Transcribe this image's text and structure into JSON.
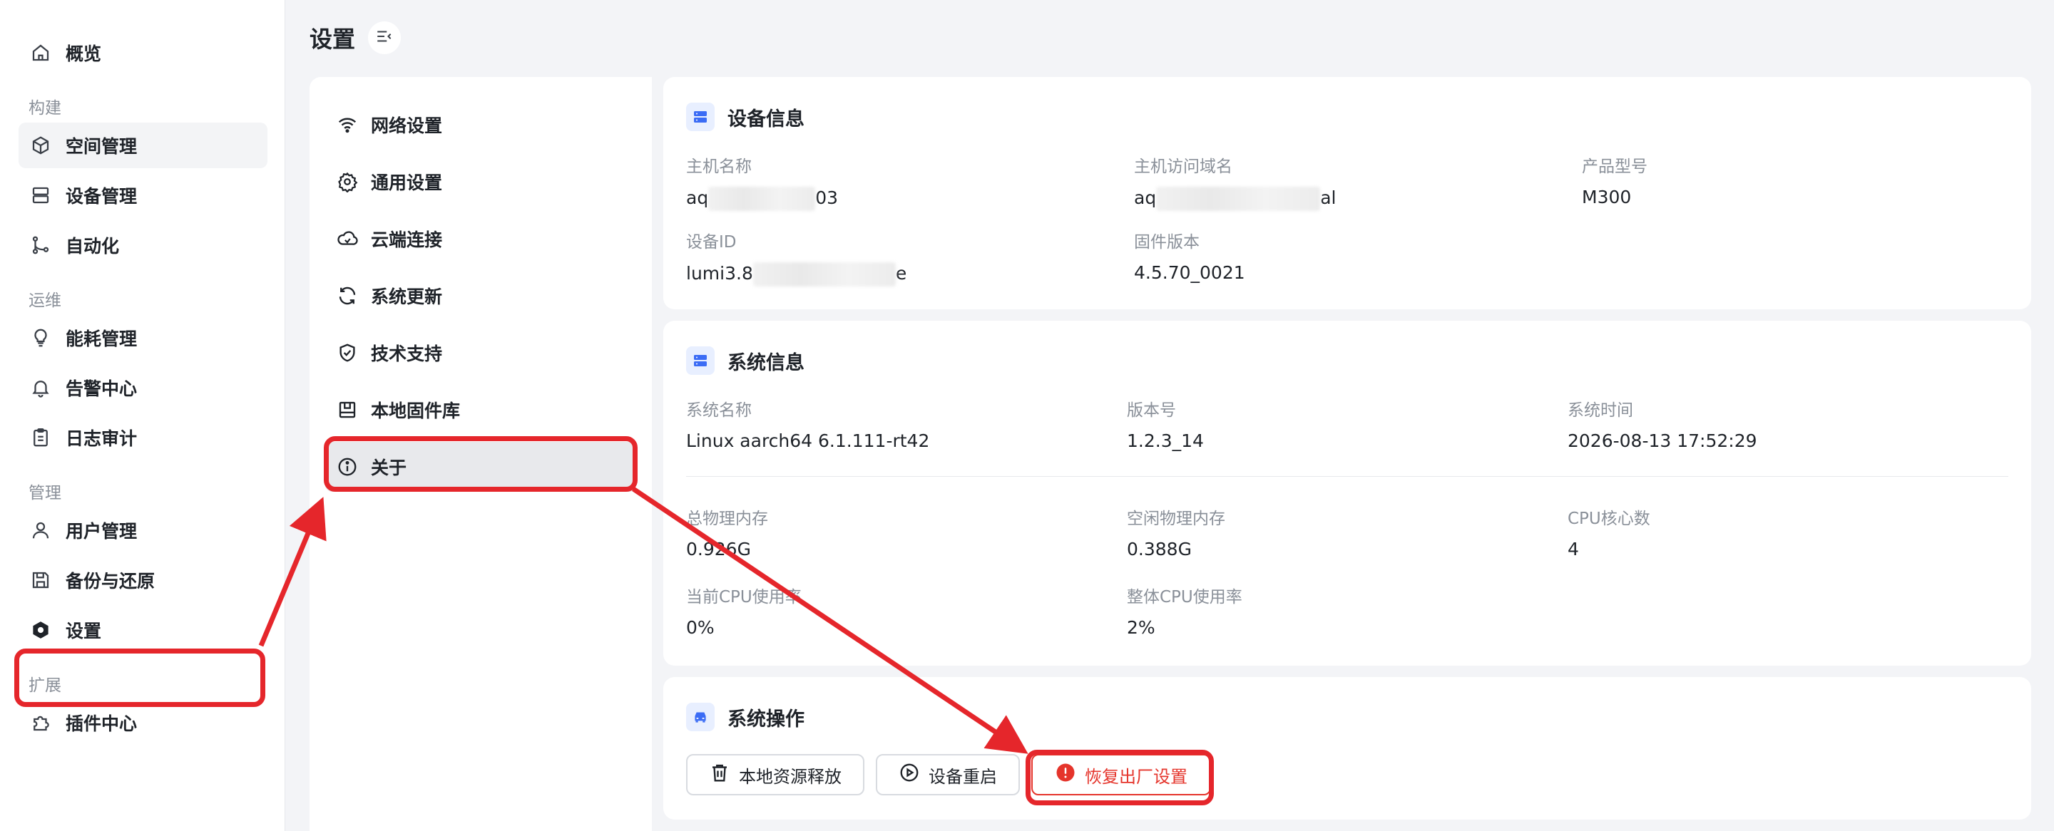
{
  "sidebar": {
    "items": [
      {
        "label": "概览",
        "icon": "home-icon"
      },
      {
        "group": "构建"
      },
      {
        "label": "空间管理",
        "icon": "cube-icon",
        "active": true
      },
      {
        "label": "设备管理",
        "icon": "server-icon"
      },
      {
        "label": "自动化",
        "icon": "branch-icon"
      },
      {
        "group": "运维"
      },
      {
        "label": "能耗管理",
        "icon": "bulb-icon"
      },
      {
        "label": "告警中心",
        "icon": "bell-icon"
      },
      {
        "label": "日志审计",
        "icon": "clipboard-icon"
      },
      {
        "group": "管理"
      },
      {
        "label": "用户管理",
        "icon": "user-icon"
      },
      {
        "label": "备份与还原",
        "icon": "save-icon"
      },
      {
        "label": "设置",
        "icon": "hexagon-settings-icon"
      },
      {
        "group": "扩展"
      },
      {
        "label": "插件中心",
        "icon": "puzzle-icon"
      }
    ]
  },
  "header": {
    "title": "设置"
  },
  "submenu": {
    "items": [
      {
        "label": "网络设置",
        "icon": "wifi-icon"
      },
      {
        "label": "通用设置",
        "icon": "gear-icon"
      },
      {
        "label": "云端连接",
        "icon": "cloud-icon"
      },
      {
        "label": "系统更新",
        "icon": "refresh-icon"
      },
      {
        "label": "技术支持",
        "icon": "shield-check-icon"
      },
      {
        "label": "本地固件库",
        "icon": "archive-icon"
      },
      {
        "label": "关于",
        "icon": "info-icon",
        "active": true
      }
    ]
  },
  "device_info": {
    "title": "设备信息",
    "hostname_label": "主机名称",
    "hostname_prefix": "aq",
    "hostname_suffix": "03",
    "domain_label": "主机访问域名",
    "domain_prefix": "aq",
    "domain_suffix": "al",
    "model_label": "产品型号",
    "model_value": "M300",
    "id_label": "设备ID",
    "id_prefix": "lumi3.8",
    "id_suffix": "e",
    "firmware_label": "固件版本",
    "firmware_value": "4.5.70_0021"
  },
  "system_info": {
    "title": "系统信息",
    "name_label": "系统名称",
    "name_value": "Linux aarch64 6.1.111-rt42",
    "version_label": "版本号",
    "version_value": "1.2.3_14",
    "time_label": "系统时间",
    "time_value": "2026-08-13 17:52:29",
    "mem_total_label": "总物理内存",
    "mem_total_value": "0.926G",
    "mem_free_label": "空闲物理内存",
    "mem_free_value": "0.388G",
    "cpu_cores_label": "CPU核心数",
    "cpu_cores_value": "4",
    "cpu_current_label": "当前CPU使用率",
    "cpu_current_value": "0%",
    "cpu_total_label": "整体CPU使用率",
    "cpu_total_value": "2%"
  },
  "system_ops": {
    "title": "系统操作",
    "release_label": "本地资源释放",
    "reboot_label": "设备重启",
    "factory_reset_label": "恢复出厂设置"
  },
  "colors": {
    "accent_blue": "#3b6cf5",
    "danger": "#e5342b",
    "annotation_red": "#e5262b"
  }
}
